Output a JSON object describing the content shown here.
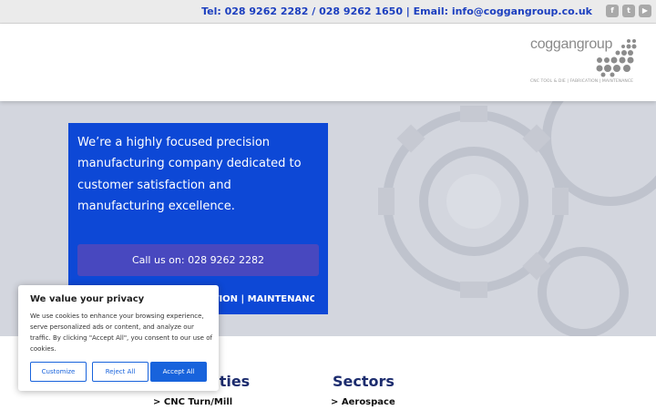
{
  "topbar": {
    "contact": "Tel: 028 9262 2282 / 028 9262 1650 | Email: info@coggangroup.co.uk",
    "social_icons": [
      "facebook-icon",
      "twitter-icon",
      "youtube-icon"
    ]
  },
  "logo": {
    "name": "coggangroup",
    "tagline": "CNC TOOL & DIE | FABRICATION | MAINTENANCE"
  },
  "hero": {
    "text": "We’re a highly focused precision manufacturing company dedicated to customer satisfaction and manufacturing excellence.",
    "call_button": "Call us on: 028 9262 2282",
    "services": "CNC TOOL & DIE | FABRICATION | MAINTENANCE"
  },
  "sections": {
    "capabilities": {
      "title": "Capabilities",
      "item": "> CNC Turn/Mill"
    },
    "sectors": {
      "title": "Sectors",
      "item": "> Aerospace"
    }
  },
  "cookie": {
    "title": "We value your privacy",
    "body": "We use cookies to enhance your browsing experience, serve personalized ads or content, and analyze our traffic. By clicking \"Accept All\", you consent to our use of cookies.",
    "customize": "Customize",
    "reject": "Reject All",
    "accept": "Accept All"
  },
  "colors": {
    "brand_blue": "#0d48d6",
    "accent_text": "#1c3fbf",
    "heading": "#1c2c6e",
    "cookie_button": "#1863dc"
  }
}
